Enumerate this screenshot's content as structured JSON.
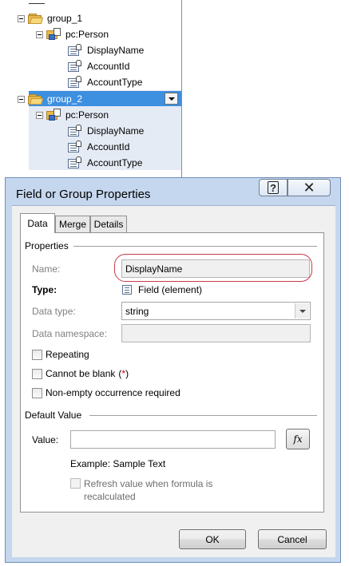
{
  "tree": {
    "nodes": [
      {
        "label": "group_1",
        "kind": "group-folder"
      },
      {
        "label": "pc:Person",
        "kind": "group"
      },
      {
        "label": "DisplayName",
        "kind": "field"
      },
      {
        "label": "AccountId",
        "kind": "field"
      },
      {
        "label": "AccountType",
        "kind": "field"
      },
      {
        "label": "group_2",
        "kind": "group-folder",
        "selected": true
      },
      {
        "label": "pc:Person",
        "kind": "group"
      },
      {
        "label": "DisplayName",
        "kind": "field"
      },
      {
        "label": "AccountId",
        "kind": "field"
      },
      {
        "label": "AccountType",
        "kind": "field"
      }
    ]
  },
  "dialog": {
    "title": "Field or Group Properties",
    "help_glyph": "?",
    "close_glyph": "✕",
    "tabs": [
      {
        "label": "Data",
        "active": true
      },
      {
        "label": "Merge",
        "active": false
      },
      {
        "label": "Details",
        "active": false
      }
    ],
    "properties": {
      "section_title": "Properties",
      "name_label": "Name:",
      "name_value": "DisplayName",
      "type_label": "Type:",
      "type_value": "Field (element)",
      "data_type_label": "Data type:",
      "data_type_value": "string",
      "namespace_label": "Data namespace:",
      "namespace_value": "",
      "repeating_label": "Repeating",
      "cannot_blank_label": "Cannot be blank",
      "cannot_blank_marker_open": "(",
      "cannot_blank_marker": "*",
      "cannot_blank_marker_close": ")",
      "nonempty_label": "Non-empty occurrence required"
    },
    "default_value": {
      "section_title": "Default Value",
      "value_label": "Value:",
      "value": "",
      "fx_label": "fx",
      "example_text": "Example: Sample Text",
      "refresh_label_line1": "Refresh value when formula is",
      "refresh_label_line2": "recalculated"
    },
    "buttons": {
      "ok": "OK",
      "cancel": "Cancel"
    }
  },
  "colors": {
    "selection": "#3d8fe0",
    "dialog_frame": "#c5d7ee",
    "highlight_oval": "#c83a4a",
    "required_marker": "#d00000"
  }
}
